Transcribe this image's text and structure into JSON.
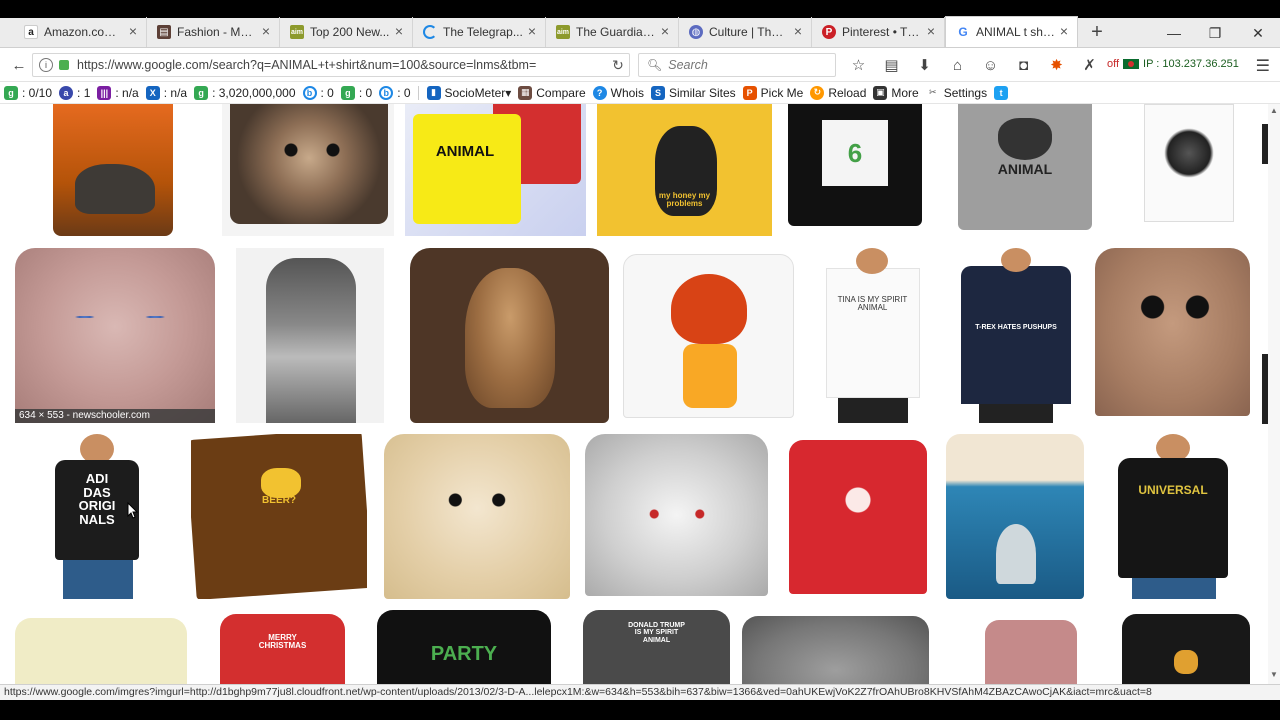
{
  "tabs": [
    {
      "title": "Amazon.com...",
      "favicon": "amazon-icon",
      "color": "#222"
    },
    {
      "title": "Fashion - Me...",
      "favicon": "newspaper-icon",
      "color": "#5d4037"
    },
    {
      "title": "Top 200 New...",
      "favicon": "aim-icon",
      "color": "#8d9a2c"
    },
    {
      "title": "The Telegrap...",
      "favicon": "loading-icon",
      "color": "#1e88e5"
    },
    {
      "title": "The Guardian...",
      "favicon": "aim-icon",
      "color": "#8d9a2c"
    },
    {
      "title": "Culture | The ...",
      "favicon": "globe-icon",
      "color": "#5c6bc0"
    },
    {
      "title": "Pinterest • Th...",
      "favicon": "pinterest-icon",
      "color": "#cb2027"
    },
    {
      "title": "ANIMAL t shi...",
      "favicon": "google-icon",
      "color": "#4285f4",
      "active": true
    }
  ],
  "nav": {
    "url": "https://www.google.com/search?q=ANIMAL+t+shirt&num=100&source=lnms&tbm=",
    "search_placeholder": "Search",
    "ip_status": "off",
    "ip_address": "IP : 103.237.36.251"
  },
  "seo_toolbar": {
    "items": [
      {
        "label": ": 0/10",
        "icon": "google-pagerank-icon"
      },
      {
        "label": ": 1",
        "icon": "alexa-icon"
      },
      {
        "label": ": n/a",
        "icon": "bars-icon"
      },
      {
        "label": ": n/a",
        "icon": "x-icon"
      },
      {
        "label": ": 3,020,000,000",
        "icon": "google-index-icon"
      },
      {
        "label": ": 0",
        "icon": "bing-icon"
      },
      {
        "label": ": 0",
        "icon": "google-cache-icon"
      },
      {
        "label": ": 0",
        "icon": "backlinks-icon"
      }
    ],
    "tools": [
      {
        "label": "SocioMeter▾",
        "icon": "chart-icon"
      },
      {
        "label": "Compare",
        "icon": "compare-icon"
      },
      {
        "label": "Whois",
        "icon": "help-icon"
      },
      {
        "label": "Similar Sites",
        "icon": "similar-sites-icon"
      },
      {
        "label": "Pick Me",
        "icon": "pick-icon"
      },
      {
        "label": "Reload",
        "icon": "reload-icon"
      },
      {
        "label": "More",
        "icon": "more-icon"
      },
      {
        "label": "Settings",
        "icon": "settings-icon"
      }
    ]
  },
  "results": {
    "hover_caption": "634 × 553 - newschooler.com",
    "caption_texts": {
      "animal": "ANIMAL",
      "animal_yellow": "ANIMAL",
      "honey": "my honey my problems",
      "tina": "TINA IS MY SPIRIT ANIMAL",
      "pushups": "T-REX HATES PUSHUPS",
      "adidas": "ADI DAS ORIGI NALS",
      "beer": "BEER?",
      "universal": "UNIVERSAL",
      "merry": "MERRY CHRISTMAS",
      "party": "PARTY",
      "trump": "DONALD TRUMP IS MY SPIRIT ANIMAL",
      "six": "6"
    }
  },
  "status_url": "https://www.google.com/imgres?imgurl=http://d1bghp9m77ju8l.cloudfront.net/wp-content/uploads/2013/02/3-D-A...lelepcx1M:&w=634&h=553&bih=637&biw=1366&ved=0ahUKEwjVoK2Z7frOAhUBro8KHVSfAhM4ZBAzCAwoCjAK&iact=mrc&uact=8"
}
